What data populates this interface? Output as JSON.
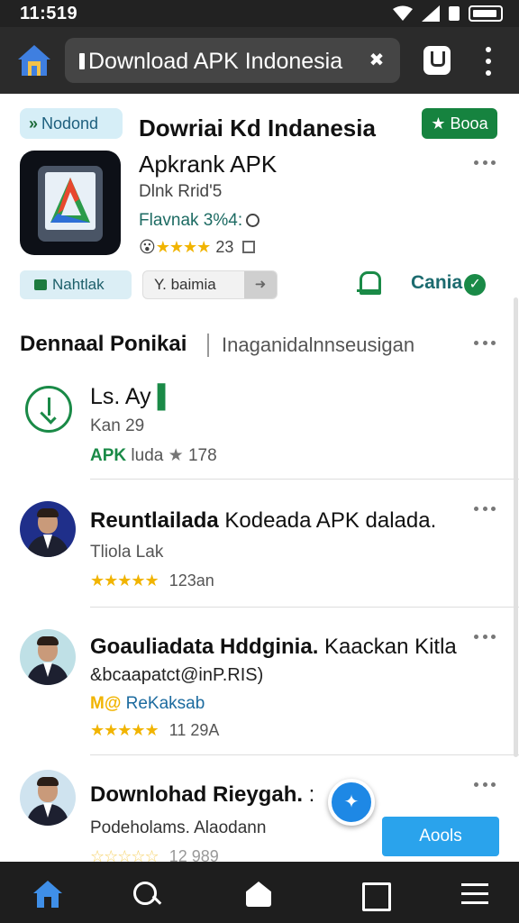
{
  "status_bar": {
    "time": "11:519",
    "icons": [
      "wifi-icon",
      "signal-icon",
      "battery-icon"
    ]
  },
  "browser": {
    "address": "Download APK Indonesia",
    "tool_glyph": "✖",
    "icons": [
      "home-icon",
      "lock-icon",
      "tab-switcher-icon",
      "more-vert-icon"
    ]
  },
  "app": {
    "badge_label": "Nodond",
    "badge_glyph": "»",
    "title": "Dowriai Kd Indanesia",
    "subtitle": "Apkrank APK",
    "developer": "Dlnk Rrid'5",
    "version": "Flavnak 3%4:",
    "rating_stars": "★★★★",
    "rating_face": "😮",
    "rating_value": "23",
    "book_label": "★ Booa",
    "rate_label": "Nahtlak",
    "share_chip_label": "Y. baimia",
    "share_chip_next": "➜",
    "share_label": "Cania",
    "share_check": "✓"
  },
  "section": {
    "title": "Dennaal Ponikai",
    "subtitle": "Inaganidalnnseusigan"
  },
  "items": [
    {
      "title": "Ls. Ay",
      "title_suffix": "▌",
      "meta": "Kan 29",
      "apk_label": "APK",
      "source": "luda",
      "rating": "178",
      "icon": "download-icon"
    },
    {
      "title_bold": "Reuntlailada",
      "title_rest": " Kodeada APK dalada.",
      "meta": "Tliola Lak",
      "stars": "★★★★★",
      "rating": "123an"
    },
    {
      "title_bold": "Goauliadata Hddginia.",
      "title_rest": " Kaackan Kitla",
      "meta": "&bcaapatct@inP.RIS)",
      "badge_left": "M@",
      "badge_text": "ReKaksab",
      "stars": "★★★★★",
      "rating": "11 29A"
    },
    {
      "title_bold": "Downlohad Rieygah.",
      "title_rest": " :",
      "meta": "Podeholams.  Alaodann",
      "stars": "☆☆☆☆☆",
      "rating": "12 989"
    }
  ],
  "fab_glyph": "✦",
  "apply_label": "Aools",
  "bottom_nav": [
    "home-icon",
    "search-icon",
    "house-icon",
    "square-icon",
    "menu-icon"
  ],
  "colors": {
    "accent_green": "#1a8a47",
    "accent_blue": "#2aa3ec",
    "star": "#f1b400",
    "toolbar": "#2b2b2b"
  }
}
